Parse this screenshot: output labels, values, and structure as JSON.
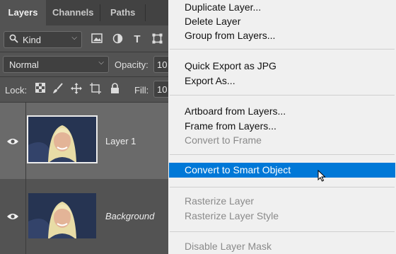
{
  "panel": {
    "tabs": [
      {
        "label": "Layers",
        "active": true
      },
      {
        "label": "Channels",
        "active": false
      },
      {
        "label": "Paths",
        "active": false
      }
    ],
    "filter": {
      "kind_label": "Kind",
      "icons": [
        "pixel-filter-icon",
        "adjustment-filter-icon",
        "type-filter-icon",
        "shape-filter-icon"
      ]
    },
    "blend_mode": "Normal",
    "opacity_label": "Opacity:",
    "opacity_value": "10",
    "lock_label": "Lock:",
    "lock_icons": [
      "lock-transparent-pixels-icon",
      "lock-image-pixels-icon",
      "lock-position-icon",
      "lock-artboard-icon",
      "lock-all-icon"
    ],
    "fill_label": "Fill:",
    "fill_value": "10",
    "layers": [
      {
        "name": "Layer 1",
        "selected": true,
        "visible": true
      },
      {
        "name": "Background",
        "selected": false,
        "visible": true
      }
    ]
  },
  "context_menu": {
    "groups": [
      [
        {
          "label": "Duplicate Layer...",
          "enabled": true
        },
        {
          "label": "Delete Layer",
          "enabled": true
        },
        {
          "label": "Group from Layers...",
          "enabled": true
        }
      ],
      [
        {
          "label": "Quick Export as JPG",
          "enabled": true
        },
        {
          "label": "Export As...",
          "enabled": true
        }
      ],
      [
        {
          "label": "Artboard from Layers...",
          "enabled": true
        },
        {
          "label": "Frame from Layers...",
          "enabled": true
        },
        {
          "label": "Convert to Frame",
          "enabled": false
        }
      ],
      [
        {
          "label": "Convert to Smart Object",
          "enabled": true,
          "highlighted": true
        }
      ],
      [
        {
          "label": "Rasterize Layer",
          "enabled": false
        },
        {
          "label": "Rasterize Layer Style",
          "enabled": false
        }
      ],
      [
        {
          "label": "Disable Layer Mask",
          "enabled": false
        }
      ]
    ],
    "highlight_color": "#0078d7"
  },
  "colors": {
    "panel_bg": "#535353",
    "selected_row": "#6a6a6a",
    "menu_bg": "#f0f0f0"
  }
}
